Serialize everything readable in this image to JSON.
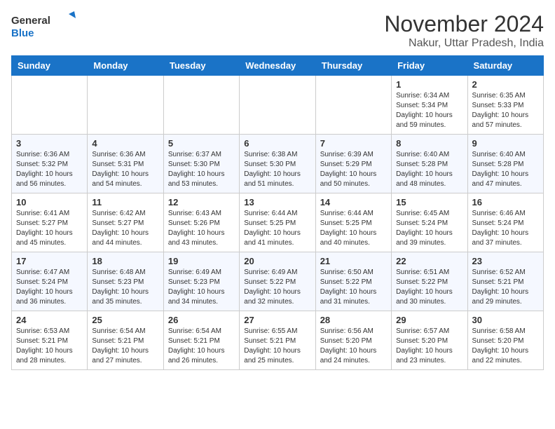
{
  "header": {
    "logo_line1": "General",
    "logo_line2": "Blue",
    "month_title": "November 2024",
    "location": "Nakur, Uttar Pradesh, India"
  },
  "calendar": {
    "days_of_week": [
      "Sunday",
      "Monday",
      "Tuesday",
      "Wednesday",
      "Thursday",
      "Friday",
      "Saturday"
    ],
    "weeks": [
      [
        {
          "day": "",
          "info": ""
        },
        {
          "day": "",
          "info": ""
        },
        {
          "day": "",
          "info": ""
        },
        {
          "day": "",
          "info": ""
        },
        {
          "day": "",
          "info": ""
        },
        {
          "day": "1",
          "info": "Sunrise: 6:34 AM\nSunset: 5:34 PM\nDaylight: 10 hours and 59 minutes."
        },
        {
          "day": "2",
          "info": "Sunrise: 6:35 AM\nSunset: 5:33 PM\nDaylight: 10 hours and 57 minutes."
        }
      ],
      [
        {
          "day": "3",
          "info": "Sunrise: 6:36 AM\nSunset: 5:32 PM\nDaylight: 10 hours and 56 minutes."
        },
        {
          "day": "4",
          "info": "Sunrise: 6:36 AM\nSunset: 5:31 PM\nDaylight: 10 hours and 54 minutes."
        },
        {
          "day": "5",
          "info": "Sunrise: 6:37 AM\nSunset: 5:30 PM\nDaylight: 10 hours and 53 minutes."
        },
        {
          "day": "6",
          "info": "Sunrise: 6:38 AM\nSunset: 5:30 PM\nDaylight: 10 hours and 51 minutes."
        },
        {
          "day": "7",
          "info": "Sunrise: 6:39 AM\nSunset: 5:29 PM\nDaylight: 10 hours and 50 minutes."
        },
        {
          "day": "8",
          "info": "Sunrise: 6:40 AM\nSunset: 5:28 PM\nDaylight: 10 hours and 48 minutes."
        },
        {
          "day": "9",
          "info": "Sunrise: 6:40 AM\nSunset: 5:28 PM\nDaylight: 10 hours and 47 minutes."
        }
      ],
      [
        {
          "day": "10",
          "info": "Sunrise: 6:41 AM\nSunset: 5:27 PM\nDaylight: 10 hours and 45 minutes."
        },
        {
          "day": "11",
          "info": "Sunrise: 6:42 AM\nSunset: 5:27 PM\nDaylight: 10 hours and 44 minutes."
        },
        {
          "day": "12",
          "info": "Sunrise: 6:43 AM\nSunset: 5:26 PM\nDaylight: 10 hours and 43 minutes."
        },
        {
          "day": "13",
          "info": "Sunrise: 6:44 AM\nSunset: 5:25 PM\nDaylight: 10 hours and 41 minutes."
        },
        {
          "day": "14",
          "info": "Sunrise: 6:44 AM\nSunset: 5:25 PM\nDaylight: 10 hours and 40 minutes."
        },
        {
          "day": "15",
          "info": "Sunrise: 6:45 AM\nSunset: 5:24 PM\nDaylight: 10 hours and 39 minutes."
        },
        {
          "day": "16",
          "info": "Sunrise: 6:46 AM\nSunset: 5:24 PM\nDaylight: 10 hours and 37 minutes."
        }
      ],
      [
        {
          "day": "17",
          "info": "Sunrise: 6:47 AM\nSunset: 5:24 PM\nDaylight: 10 hours and 36 minutes."
        },
        {
          "day": "18",
          "info": "Sunrise: 6:48 AM\nSunset: 5:23 PM\nDaylight: 10 hours and 35 minutes."
        },
        {
          "day": "19",
          "info": "Sunrise: 6:49 AM\nSunset: 5:23 PM\nDaylight: 10 hours and 34 minutes."
        },
        {
          "day": "20",
          "info": "Sunrise: 6:49 AM\nSunset: 5:22 PM\nDaylight: 10 hours and 32 minutes."
        },
        {
          "day": "21",
          "info": "Sunrise: 6:50 AM\nSunset: 5:22 PM\nDaylight: 10 hours and 31 minutes."
        },
        {
          "day": "22",
          "info": "Sunrise: 6:51 AM\nSunset: 5:22 PM\nDaylight: 10 hours and 30 minutes."
        },
        {
          "day": "23",
          "info": "Sunrise: 6:52 AM\nSunset: 5:21 PM\nDaylight: 10 hours and 29 minutes."
        }
      ],
      [
        {
          "day": "24",
          "info": "Sunrise: 6:53 AM\nSunset: 5:21 PM\nDaylight: 10 hours and 28 minutes."
        },
        {
          "day": "25",
          "info": "Sunrise: 6:54 AM\nSunset: 5:21 PM\nDaylight: 10 hours and 27 minutes."
        },
        {
          "day": "26",
          "info": "Sunrise: 6:54 AM\nSunset: 5:21 PM\nDaylight: 10 hours and 26 minutes."
        },
        {
          "day": "27",
          "info": "Sunrise: 6:55 AM\nSunset: 5:21 PM\nDaylight: 10 hours and 25 minutes."
        },
        {
          "day": "28",
          "info": "Sunrise: 6:56 AM\nSunset: 5:20 PM\nDaylight: 10 hours and 24 minutes."
        },
        {
          "day": "29",
          "info": "Sunrise: 6:57 AM\nSunset: 5:20 PM\nDaylight: 10 hours and 23 minutes."
        },
        {
          "day": "30",
          "info": "Sunrise: 6:58 AM\nSunset: 5:20 PM\nDaylight: 10 hours and 22 minutes."
        }
      ]
    ]
  }
}
